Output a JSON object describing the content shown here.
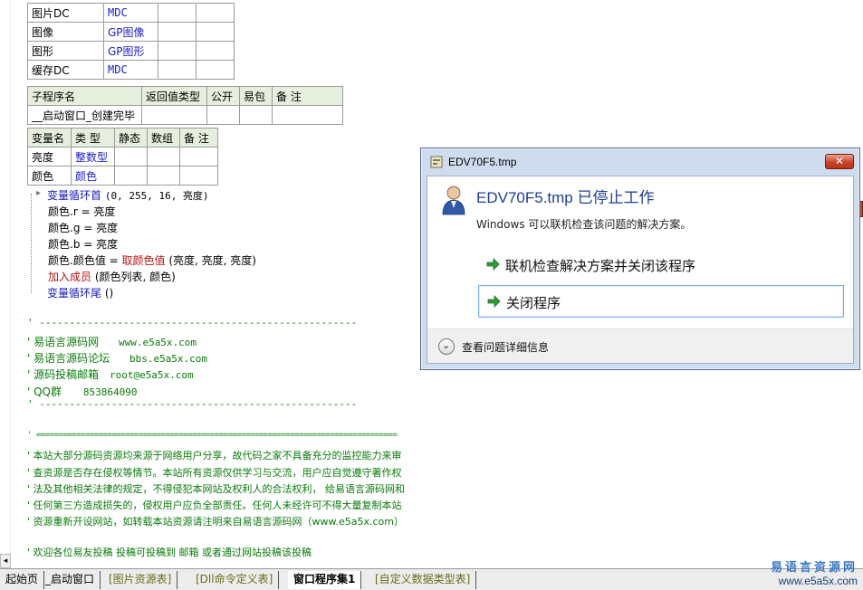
{
  "table_top": {
    "rows": [
      [
        "图片DC",
        "MDC"
      ],
      [
        "图像",
        "GP图像"
      ],
      [
        "图形",
        "GP图形"
      ],
      [
        "缓存DC",
        "MDC"
      ]
    ]
  },
  "sub_table": {
    "headers": [
      "子程序名",
      "返回值类型",
      "公开",
      "易包",
      "备 注"
    ],
    "row": [
      "__启动窗口_创建完毕",
      "",
      "",
      "",
      ""
    ]
  },
  "var_table": {
    "headers": [
      "变量名",
      "类 型",
      "静态",
      "数组",
      "备 注"
    ],
    "rows": [
      [
        "亮度",
        "整数型",
        "",
        "",
        ""
      ],
      [
        "颜色",
        "颜色",
        "",
        "",
        ""
      ]
    ]
  },
  "code": {
    "loop_start_kw": "变量循环首",
    "loop_start_args": "(0, 255, 16, 亮度)",
    "line_r": "颜色.r = 亮度",
    "line_g": "颜色.g = 亮度",
    "line_b": "颜色.b = 亮度",
    "line_val_prefix": "颜色.颜色值 = ",
    "line_val_fn": "取颜色值",
    "line_val_args": " (亮度, 亮度, 亮度)",
    "add_member_fn": "加入成员",
    "add_member_args": " (颜色列表, 颜色)",
    "loop_end_kw": "变量循环尾",
    "loop_end_args": " ()"
  },
  "comments": {
    "sep1": "' -----------------------------------------------------",
    "site_label": "' 易语言源码网",
    "site_url": "www.e5a5x.com",
    "forum_label": "' 易语言源码论坛",
    "forum_url": "bbs.e5a5x.com",
    "mail_label": "' 源码投稿邮箱",
    "mail_addr": "root@e5a5x.com",
    "qq_label": "' QQ群",
    "qq_num": "853864090",
    "sep2": "' -----------------------------------------------------",
    "sep3": "' =================================================================================",
    "notice1": "' 本站大部分源码资源均来源于网络用户分享，故代码之家不具备充分的监控能力来审",
    "notice2": "' 查资源是否存在侵权等情节。本站所有资源仅供学习与交流，用户应自觉遵守著作权",
    "notice3": "' 法及其他相关法律的规定，不得侵犯本网站及权利人的合法权利， 给易语言源码网和",
    "notice4": "' 任何第三方造成损失的，侵权用户应负全部责任。任何人未经许可不得大量复制本站",
    "notice5": "' 资源重新开设网站，如转载本站资源请注明来自易语言源码网（www.e5a5x.com）",
    "notice6": "' 欢迎各位易友投稿 投稿可投稿到        邮箱 或者通过网站投稿该投稿"
  },
  "tabs": [
    {
      "label": "起始页"
    },
    {
      "label": "_启动窗口"
    },
    {
      "label": "[图片资源表]"
    },
    {
      "label": "[Dll命令定义表]"
    },
    {
      "label": "窗口程序集1"
    },
    {
      "label": "[自定义数据类型表]"
    }
  ],
  "brand": {
    "name": "易语言资源网",
    "url": "www.e5a5x.com"
  },
  "dialog": {
    "title": "EDV70F5.tmp",
    "close_glyph": "✕",
    "heading": "EDV70F5.tmp 已停止工作",
    "description": "Windows 可以联机检查该问题的解决方案。",
    "option_check": "联机检查解决方案并关闭该程序",
    "option_close": "关闭程序",
    "details_label": "查看问题详细信息"
  }
}
